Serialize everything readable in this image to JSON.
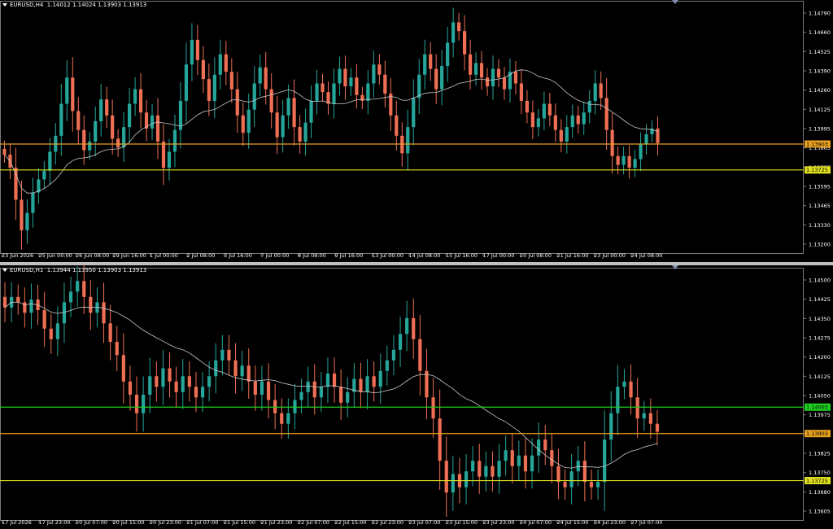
{
  "colors": {
    "background": "#000000",
    "bull": "#26a69a",
    "bear": "#ef6f55",
    "ma": "#c8c8c8",
    "axis_text": "#ffffff",
    "frame": "#7a7a7a"
  },
  "charts": [
    {
      "id": "chart1",
      "symbol_label": "EURUSD,H4",
      "ohlc": "1.14012 1.14024 1.13903 1.13913",
      "price_ticks": [
        "1.14790",
        "1.14660",
        "1.14525",
        "1.14390",
        "1.14260",
        "1.14125",
        "1.13995",
        "1.13865",
        "1.13735",
        "1.13595",
        "1.13465",
        "1.13330",
        "1.13200"
      ],
      "price_range": [
        1.1317,
        1.1486
      ],
      "time_labels": [
        "23 Jun 2026",
        "25 Jun 00:00",
        "26 Jun 08:00",
        "29 Jun 16:00",
        "1 Jul 00:00",
        "2 Jul 08:00",
        "3 Jul 16:00",
        "7 Jul 00:00",
        "8 Jul 08:00",
        "9 Jul 16:00",
        "13 Jul 00:00",
        "14 Jul 08:00",
        "15 Jul 16:00",
        "17 Jul 00:00",
        "20 Jul 08:00",
        "21 Jul 16:00",
        "23 Jul 00:00",
        "24 Jul 08:00"
      ],
      "levels": [
        {
          "price": 1.13903,
          "label": "1.13903",
          "color": "#e8a020"
        },
        {
          "price": 1.13725,
          "label": "1.13725",
          "color": "#e0e020"
        }
      ],
      "closes": [
        1.1383,
        1.1374,
        1.1352,
        1.1331,
        1.1343,
        1.1357,
        1.1366,
        1.1372,
        1.1385,
        1.1396,
        1.1418,
        1.1436,
        1.1413,
        1.14,
        1.1386,
        1.1392,
        1.1406,
        1.1421,
        1.141,
        1.1394,
        1.1388,
        1.1402,
        1.1418,
        1.1428,
        1.1412,
        1.1401,
        1.141,
        1.1392,
        1.1374,
        1.1385,
        1.14,
        1.142,
        1.1445,
        1.1462,
        1.1448,
        1.1435,
        1.142,
        1.1438,
        1.1452,
        1.144,
        1.1428,
        1.141,
        1.1398,
        1.1414,
        1.1432,
        1.1443,
        1.1428,
        1.1412,
        1.1395,
        1.141,
        1.1422,
        1.1402,
        1.1392,
        1.1405,
        1.142,
        1.1432,
        1.1426,
        1.1418,
        1.1432,
        1.1442,
        1.143,
        1.1436,
        1.1424,
        1.142,
        1.1432,
        1.1445,
        1.1438,
        1.1425,
        1.141,
        1.1396,
        1.1384,
        1.1402,
        1.1422,
        1.1438,
        1.1452,
        1.1442,
        1.1428,
        1.1444,
        1.146,
        1.1474,
        1.1468,
        1.1452,
        1.1438,
        1.1446,
        1.1436,
        1.143,
        1.1442,
        1.1436,
        1.1428,
        1.144,
        1.1432,
        1.142,
        1.1412,
        1.1402,
        1.1408,
        1.1418,
        1.141,
        1.14,
        1.1392,
        1.1402,
        1.141,
        1.1404,
        1.1412,
        1.142,
        1.1432,
        1.1422,
        1.14,
        1.1382,
        1.1376,
        1.1382,
        1.1374,
        1.138,
        1.139,
        1.1397,
        1.1401,
        1.1391
      ]
    },
    {
      "id": "chart2",
      "symbol_label": "EURUSD,H1",
      "ohlc": "1.13944 1.13950 1.13903 1.13913",
      "price_ticks": [
        "1.14500",
        "1.14425",
        "1.14350",
        "1.14275",
        "1.14200",
        "1.14125",
        "1.14050",
        "1.13975",
        "1.13900",
        "1.13825",
        "1.13750",
        "1.13680",
        "1.13605"
      ],
      "price_range": [
        1.13585,
        1.14515
      ],
      "time_labels": [
        "17 Jul 2026",
        "17 Jul 23:00",
        "20 Jul 07:00",
        "20 Jul 15:00",
        "20 Jul 23:00",
        "21 Jul 07:00",
        "21 Jul 15:00",
        "21 Jul 23:00",
        "22 Jul 07:00",
        "22 Jul 15:00",
        "22 Jul 23:00",
        "23 Jul 07:00",
        "23 Jul 15:00",
        "23 Jul 23:00",
        "24 Jul 07:00",
        "24 Jul 15:00",
        "24 Jul 23:00",
        "27 Jul 07:00"
      ],
      "levels": [
        {
          "price": 1.14003,
          "label": "1.14003",
          "color": "#20d020"
        },
        {
          "price": 1.13903,
          "label": "1.13903",
          "color": "#e8a020"
        },
        {
          "price": 1.13725,
          "label": "1.13725",
          "color": "#e0e020"
        }
      ],
      "closes": [
        1.1438,
        1.1442,
        1.144,
        1.1436,
        1.1441,
        1.1437,
        1.143,
        1.1426,
        1.1432,
        1.144,
        1.1444,
        1.1448,
        1.1442,
        1.1436,
        1.144,
        1.1432,
        1.1425,
        1.142,
        1.141,
        1.1405,
        1.1398,
        1.1405,
        1.1412,
        1.1408,
        1.1415,
        1.141,
        1.1406,
        1.1412,
        1.1408,
        1.1404,
        1.1408,
        1.1412,
        1.1418,
        1.1422,
        1.1418,
        1.1412,
        1.1416,
        1.141,
        1.1405,
        1.141,
        1.1403,
        1.1398,
        1.1394,
        1.1398,
        1.1403,
        1.1406,
        1.141,
        1.1404,
        1.1408,
        1.1413,
        1.1408,
        1.1402,
        1.1406,
        1.1411,
        1.1406,
        1.1412,
        1.1408,
        1.1414,
        1.1418,
        1.1422,
        1.1428,
        1.1434,
        1.1426,
        1.1414,
        1.1404,
        1.1396,
        1.138,
        1.1368,
        1.1375,
        1.137,
        1.1376,
        1.138,
        1.1374,
        1.1378,
        1.1374,
        1.138,
        1.1384,
        1.1378,
        1.1382,
        1.1376,
        1.1382,
        1.1388,
        1.1384,
        1.1378,
        1.1372,
        1.137,
        1.1376,
        1.138,
        1.1372,
        1.137,
        1.1372,
        1.1388,
        1.1398,
        1.1408,
        1.141,
        1.1404,
        1.1396,
        1.1398,
        1.1394,
        1.1391
      ]
    }
  ]
}
